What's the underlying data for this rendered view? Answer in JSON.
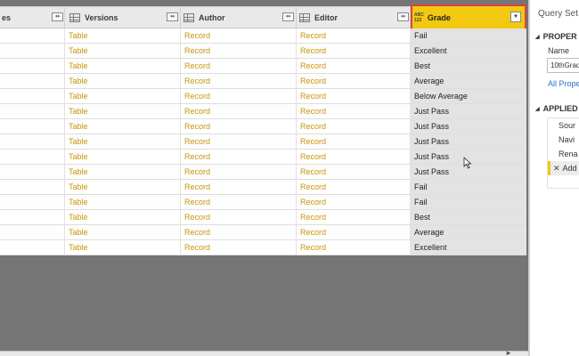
{
  "grid": {
    "first_col_partial": "es",
    "columns": [
      {
        "name": "Versions"
      },
      {
        "name": "Author"
      },
      {
        "name": "Editor"
      }
    ],
    "grade_column": {
      "type_badge_top": "ABC",
      "type_badge_bottom": "123",
      "name": "Grade",
      "dropdown_icon": "▼"
    },
    "expand_icon": "↔",
    "rows": [
      {
        "versions": "Table",
        "author": "Record",
        "editor": "Record",
        "grade": "Fail"
      },
      {
        "versions": "Table",
        "author": "Record",
        "editor": "Record",
        "grade": "Excellent"
      },
      {
        "versions": "Table",
        "author": "Record",
        "editor": "Record",
        "grade": "Best"
      },
      {
        "versions": "Table",
        "author": "Record",
        "editor": "Record",
        "grade": "Average"
      },
      {
        "versions": "Table",
        "author": "Record",
        "editor": "Record",
        "grade": "Below Average"
      },
      {
        "versions": "Table",
        "author": "Record",
        "editor": "Record",
        "grade": "Just Pass"
      },
      {
        "versions": "Table",
        "author": "Record",
        "editor": "Record",
        "grade": "Just Pass"
      },
      {
        "versions": "Table",
        "author": "Record",
        "editor": "Record",
        "grade": "Just Pass"
      },
      {
        "versions": "Table",
        "author": "Record",
        "editor": "Record",
        "grade": "Just Pass"
      },
      {
        "versions": "Table",
        "author": "Record",
        "editor": "Record",
        "grade": "Just Pass"
      },
      {
        "versions": "Table",
        "author": "Record",
        "editor": "Record",
        "grade": "Fail"
      },
      {
        "versions": "Table",
        "author": "Record",
        "editor": "Record",
        "grade": "Fail"
      },
      {
        "versions": "Table",
        "author": "Record",
        "editor": "Record",
        "grade": "Best"
      },
      {
        "versions": "Table",
        "author": "Record",
        "editor": "Record",
        "grade": "Average"
      },
      {
        "versions": "Table",
        "author": "Record",
        "editor": "Record",
        "grade": "Excellent"
      }
    ]
  },
  "query_settings": {
    "title": "Query Set",
    "properties_heading": "PROPER",
    "name_label": "Name",
    "name_value": "10thGrad",
    "all_properties_link": "All Prope",
    "applied_heading": "APPLIED",
    "steps": [
      {
        "label": "Sour",
        "selected": false
      },
      {
        "label": "Navi",
        "selected": false
      },
      {
        "label": "Rena",
        "selected": false
      },
      {
        "label": "Add",
        "selected": true,
        "delete_icon": "✕"
      }
    ]
  },
  "colors": {
    "accent": "#f2c811",
    "highlight_border": "#e0403c",
    "link_value": "#c7960c",
    "background": "#757575"
  },
  "icons": [
    "table-icon",
    "expand-icon",
    "dropdown-icon",
    "mouse-cursor-icon",
    "collapse-triangle-icon",
    "delete-step-icon"
  ]
}
